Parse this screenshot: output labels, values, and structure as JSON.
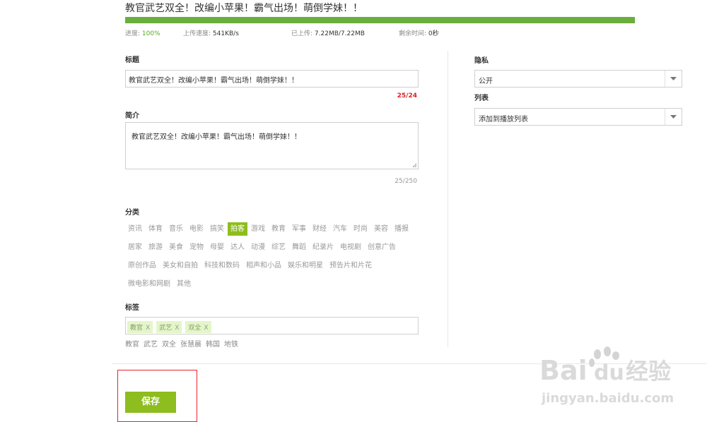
{
  "upload": {
    "title": "教官武艺双全！改编小苹果！霸气出场！萌倒学妹！！",
    "progress_fraction": 1.0,
    "progress_label": "进度:",
    "progress_value": "100%",
    "speed_label": "上传速度:",
    "speed_value": "541KB/s",
    "uploaded_label": "已上传:",
    "uploaded_value": "7.22MB/7.22MB",
    "remaining_label": "剩余时间:",
    "remaining_value": "0秒"
  },
  "form": {
    "title_label": "标题",
    "title_value": "教官武艺双全！改编小苹果！霸气出场！萌倒学妹！！",
    "title_counter": "25/24",
    "desc_label": "简介",
    "desc_value": "教官武艺双全！改编小苹果！霸气出场！萌倒学妹！！",
    "desc_counter": "25/250",
    "category_label": "分类",
    "categories": [
      "资讯",
      "体育",
      "音乐",
      "电影",
      "搞笑",
      "拍客",
      "游戏",
      "教育",
      "军事",
      "财经",
      "汽车",
      "时尚",
      "美容",
      "播报",
      "居家",
      "旅游",
      "美食",
      "宠物",
      "母婴",
      "达人",
      "动漫",
      "综艺",
      "舞蹈",
      "纪录片",
      "电视剧",
      "创意广告",
      "原创作品",
      "美女和自拍",
      "科技和数码",
      "相声和小品",
      "娱乐和明星",
      "预告片和片花",
      "微电影和网剧",
      "其他"
    ],
    "active_category": "拍客",
    "tags_label": "标签",
    "tags": [
      "教官",
      "武艺",
      "双全"
    ],
    "tag_remove_glyph": "X",
    "suggested_tags": [
      "教官",
      "武艺",
      "双全",
      "张慧晨",
      "韩国",
      "地铁"
    ],
    "save_label": "保存"
  },
  "side": {
    "privacy_label": "隐私",
    "privacy_value": "公开",
    "playlist_label": "列表",
    "playlist_value": "添加到播放列表"
  },
  "watermark": {
    "brand": "Bai",
    "brand2": "du",
    "cn": "经验",
    "url": "jingyan.baidu.com"
  },
  "colors": {
    "accent": "#8dbd1e",
    "progress": "#6aaf3d",
    "error": "#e02020"
  }
}
